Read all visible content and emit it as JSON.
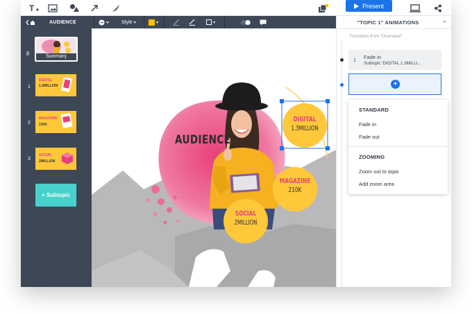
{
  "topbar": {
    "icons": [
      "text-icon",
      "image-icon",
      "shapes-icon",
      "arrow-icon",
      "draw-icon",
      "collaborator-icon",
      "preview-icon",
      "share-icon"
    ],
    "text_tool_label": "T",
    "present_label": "Present"
  },
  "editbar": {
    "back_label": "AUDIENCE",
    "style_label": "Style",
    "color_swatch": "#ffc107"
  },
  "sidebar": {
    "summary_label": "Summary",
    "slides": [
      {
        "num": "1",
        "line1": "DIGITAL",
        "line2": "1.3MILLION"
      },
      {
        "num": "2",
        "line1": "MAGAZINE",
        "line2": "210K"
      },
      {
        "num": "3",
        "line1": "SOCIAL",
        "line2": "2MILLION"
      }
    ],
    "subtopic_label": "+ Subtopic"
  },
  "canvas": {
    "title": "AUDIENCE",
    "bubbles": [
      {
        "label": "DIGITAL",
        "value": "1.3MILLION"
      },
      {
        "label": "MAGAZINE",
        "value": "210K"
      },
      {
        "label": "SOCIAL",
        "value": "2MILLION"
      }
    ]
  },
  "panel": {
    "title": "\"TOPIC 1\" ANIMATIONS",
    "close": "×",
    "transition_from": "Transition from \"Overview\"",
    "animation": {
      "num": "1",
      "title": "Fade in",
      "subtitle": "Subtopic 'DIGITAL 1.3MILLI..."
    },
    "add_symbol": "+",
    "dropdown": {
      "standard_heading": "STANDARD",
      "standard_items": [
        "Fade in",
        "Fade out"
      ],
      "zooming_heading": "ZOOMING",
      "zooming_items": [
        "Zoom out to topic",
        "Add zoom area"
      ]
    }
  },
  "colors": {
    "accent": "#1a73e8",
    "sidebar": "#3d4756",
    "bubble": "#ffc83a",
    "pink": "#e8407a",
    "teal": "#48d1cc"
  }
}
